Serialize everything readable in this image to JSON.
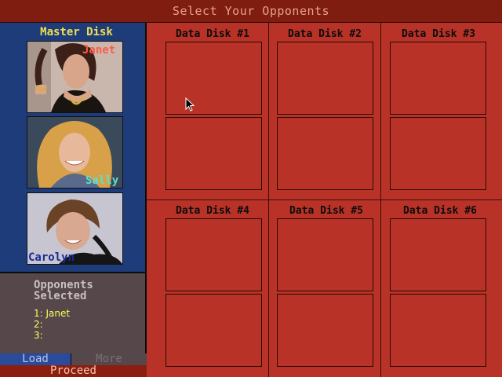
{
  "title": "Select Your Opponents",
  "master_disk": {
    "label": "Master Disk",
    "portraits": [
      {
        "name": "Janet",
        "name_color": "#ff5a4a"
      },
      {
        "name": "Sally",
        "name_color": "#5ae0c8"
      },
      {
        "name": "Carolyn",
        "name_color": "#1a2a9a"
      }
    ]
  },
  "data_disks": [
    {
      "label": "Data Disk #1"
    },
    {
      "label": "Data Disk #2"
    },
    {
      "label": "Data Disk #3"
    },
    {
      "label": "Data Disk #4"
    },
    {
      "label": "Data Disk #5"
    },
    {
      "label": "Data Disk #6"
    }
  ],
  "selected": {
    "title_line1": "Opponents",
    "title_line2": "Selected",
    "entries": [
      "1: Janet",
      "2:",
      "3:"
    ]
  },
  "buttons": {
    "load": "Load",
    "more": "More",
    "proceed": "Proceed"
  }
}
